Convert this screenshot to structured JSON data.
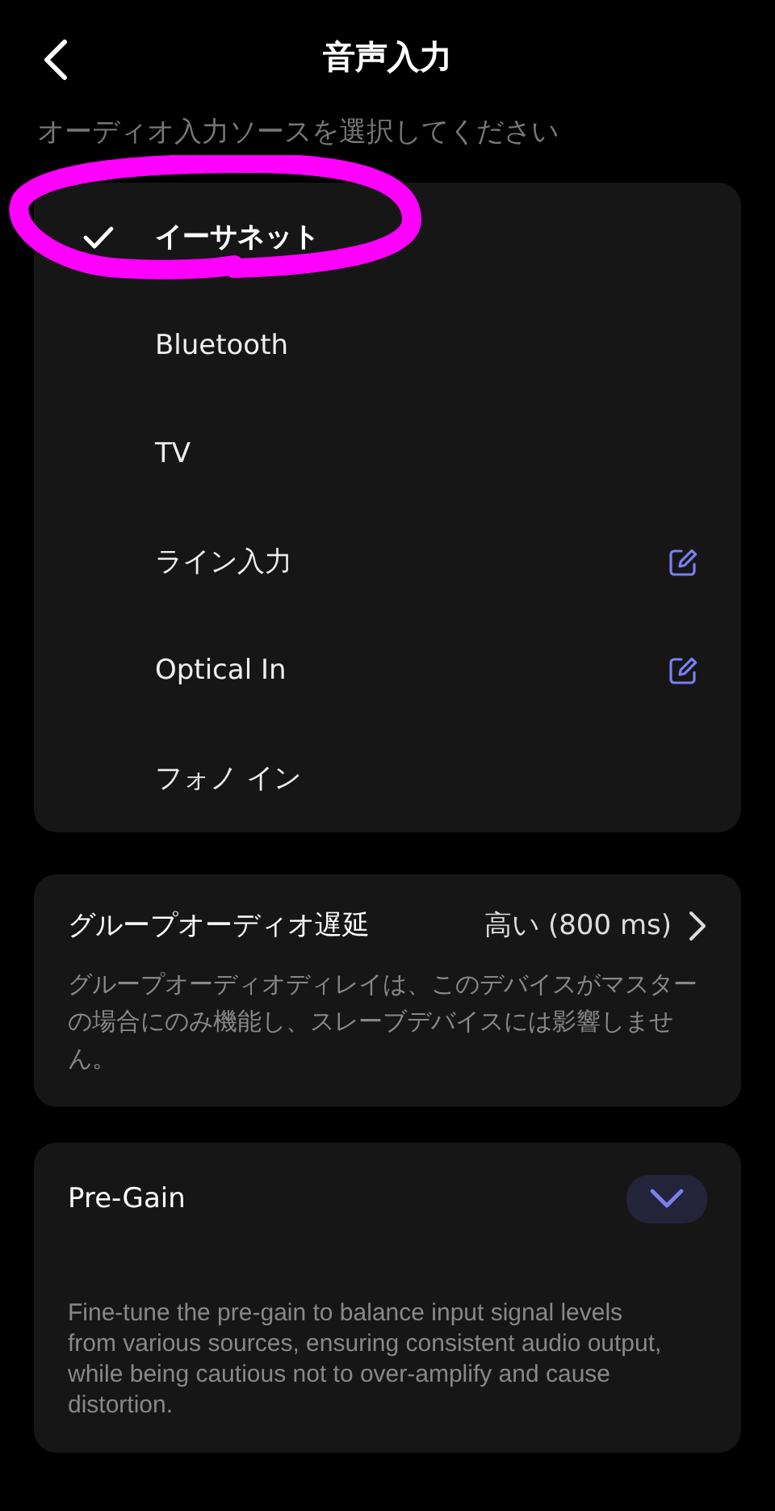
{
  "header": {
    "title": "音声入力"
  },
  "subtitle": "オーディオ入力ソースを選択してください",
  "sources": [
    {
      "label": "イーサネット",
      "selected": true,
      "editable": false
    },
    {
      "label": "Bluetooth",
      "selected": false,
      "editable": false
    },
    {
      "label": "TV",
      "selected": false,
      "editable": false
    },
    {
      "label": "ライン入力",
      "selected": false,
      "editable": true
    },
    {
      "label": "Optical In",
      "selected": false,
      "editable": true
    },
    {
      "label": "フォノ イン",
      "selected": false,
      "editable": false
    }
  ],
  "latency": {
    "title": "グループオーディオ遅延",
    "value": "高い (800 ms)",
    "description": "グループオーディオディレイは、このデバイスがマスターの場合にのみ機能し、スレーブデバイスには影響しません。"
  },
  "pregain": {
    "title": "Pre-Gain",
    "expanded": false,
    "description": "Fine-tune the pre-gain to balance input signal levels from various sources, ensuring consistent audio output, while being cautious not to over-amplify and cause distortion."
  }
}
